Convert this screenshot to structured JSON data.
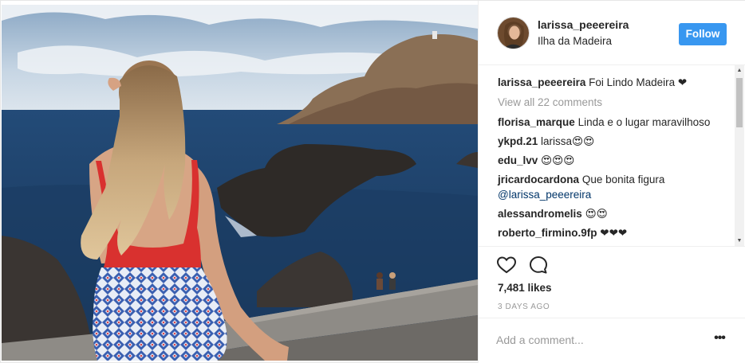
{
  "post": {
    "image_alt": "Woman in red swimsuit and patterned shorts sitting on a wall overlooking the ocean and rocky coastline",
    "header": {
      "username": "larissa_peeereira",
      "location": "Ilha da Madeira",
      "follow_label": "Follow"
    },
    "caption": {
      "author": "larissa_peeereira",
      "text": "Foi Lindo Madeira ❤"
    },
    "view_all_label": "View all 22 comments",
    "comments": [
      {
        "author": "florisa_marque",
        "text": "Linda e o lugar maravilhoso"
      },
      {
        "author": "ykpd.21",
        "text": "larissa😍😍"
      },
      {
        "author": "edu_lvv",
        "text": "😍😍😍"
      },
      {
        "author": "jricardocardona",
        "text": "Que bonita figura",
        "mention": "@larissa_peeereira"
      },
      {
        "author": "alessandromelis",
        "text": "😍😍"
      },
      {
        "author": "roberto_firmino.9fp",
        "text": "❤❤❤"
      }
    ],
    "likes": "7,481 likes",
    "date": "3 DAYS AGO",
    "add_comment_placeholder": "Add a comment...",
    "more_label": "•••"
  },
  "icons": {
    "like": "heart-icon",
    "comment": "comment-icon",
    "scroll_up": "scroll-up-arrow",
    "scroll_down": "scroll-down-arrow"
  },
  "colors": {
    "follow_button": "#3897f0",
    "muted_text": "#999999",
    "mention": "#003569",
    "divider": "#efefef"
  }
}
